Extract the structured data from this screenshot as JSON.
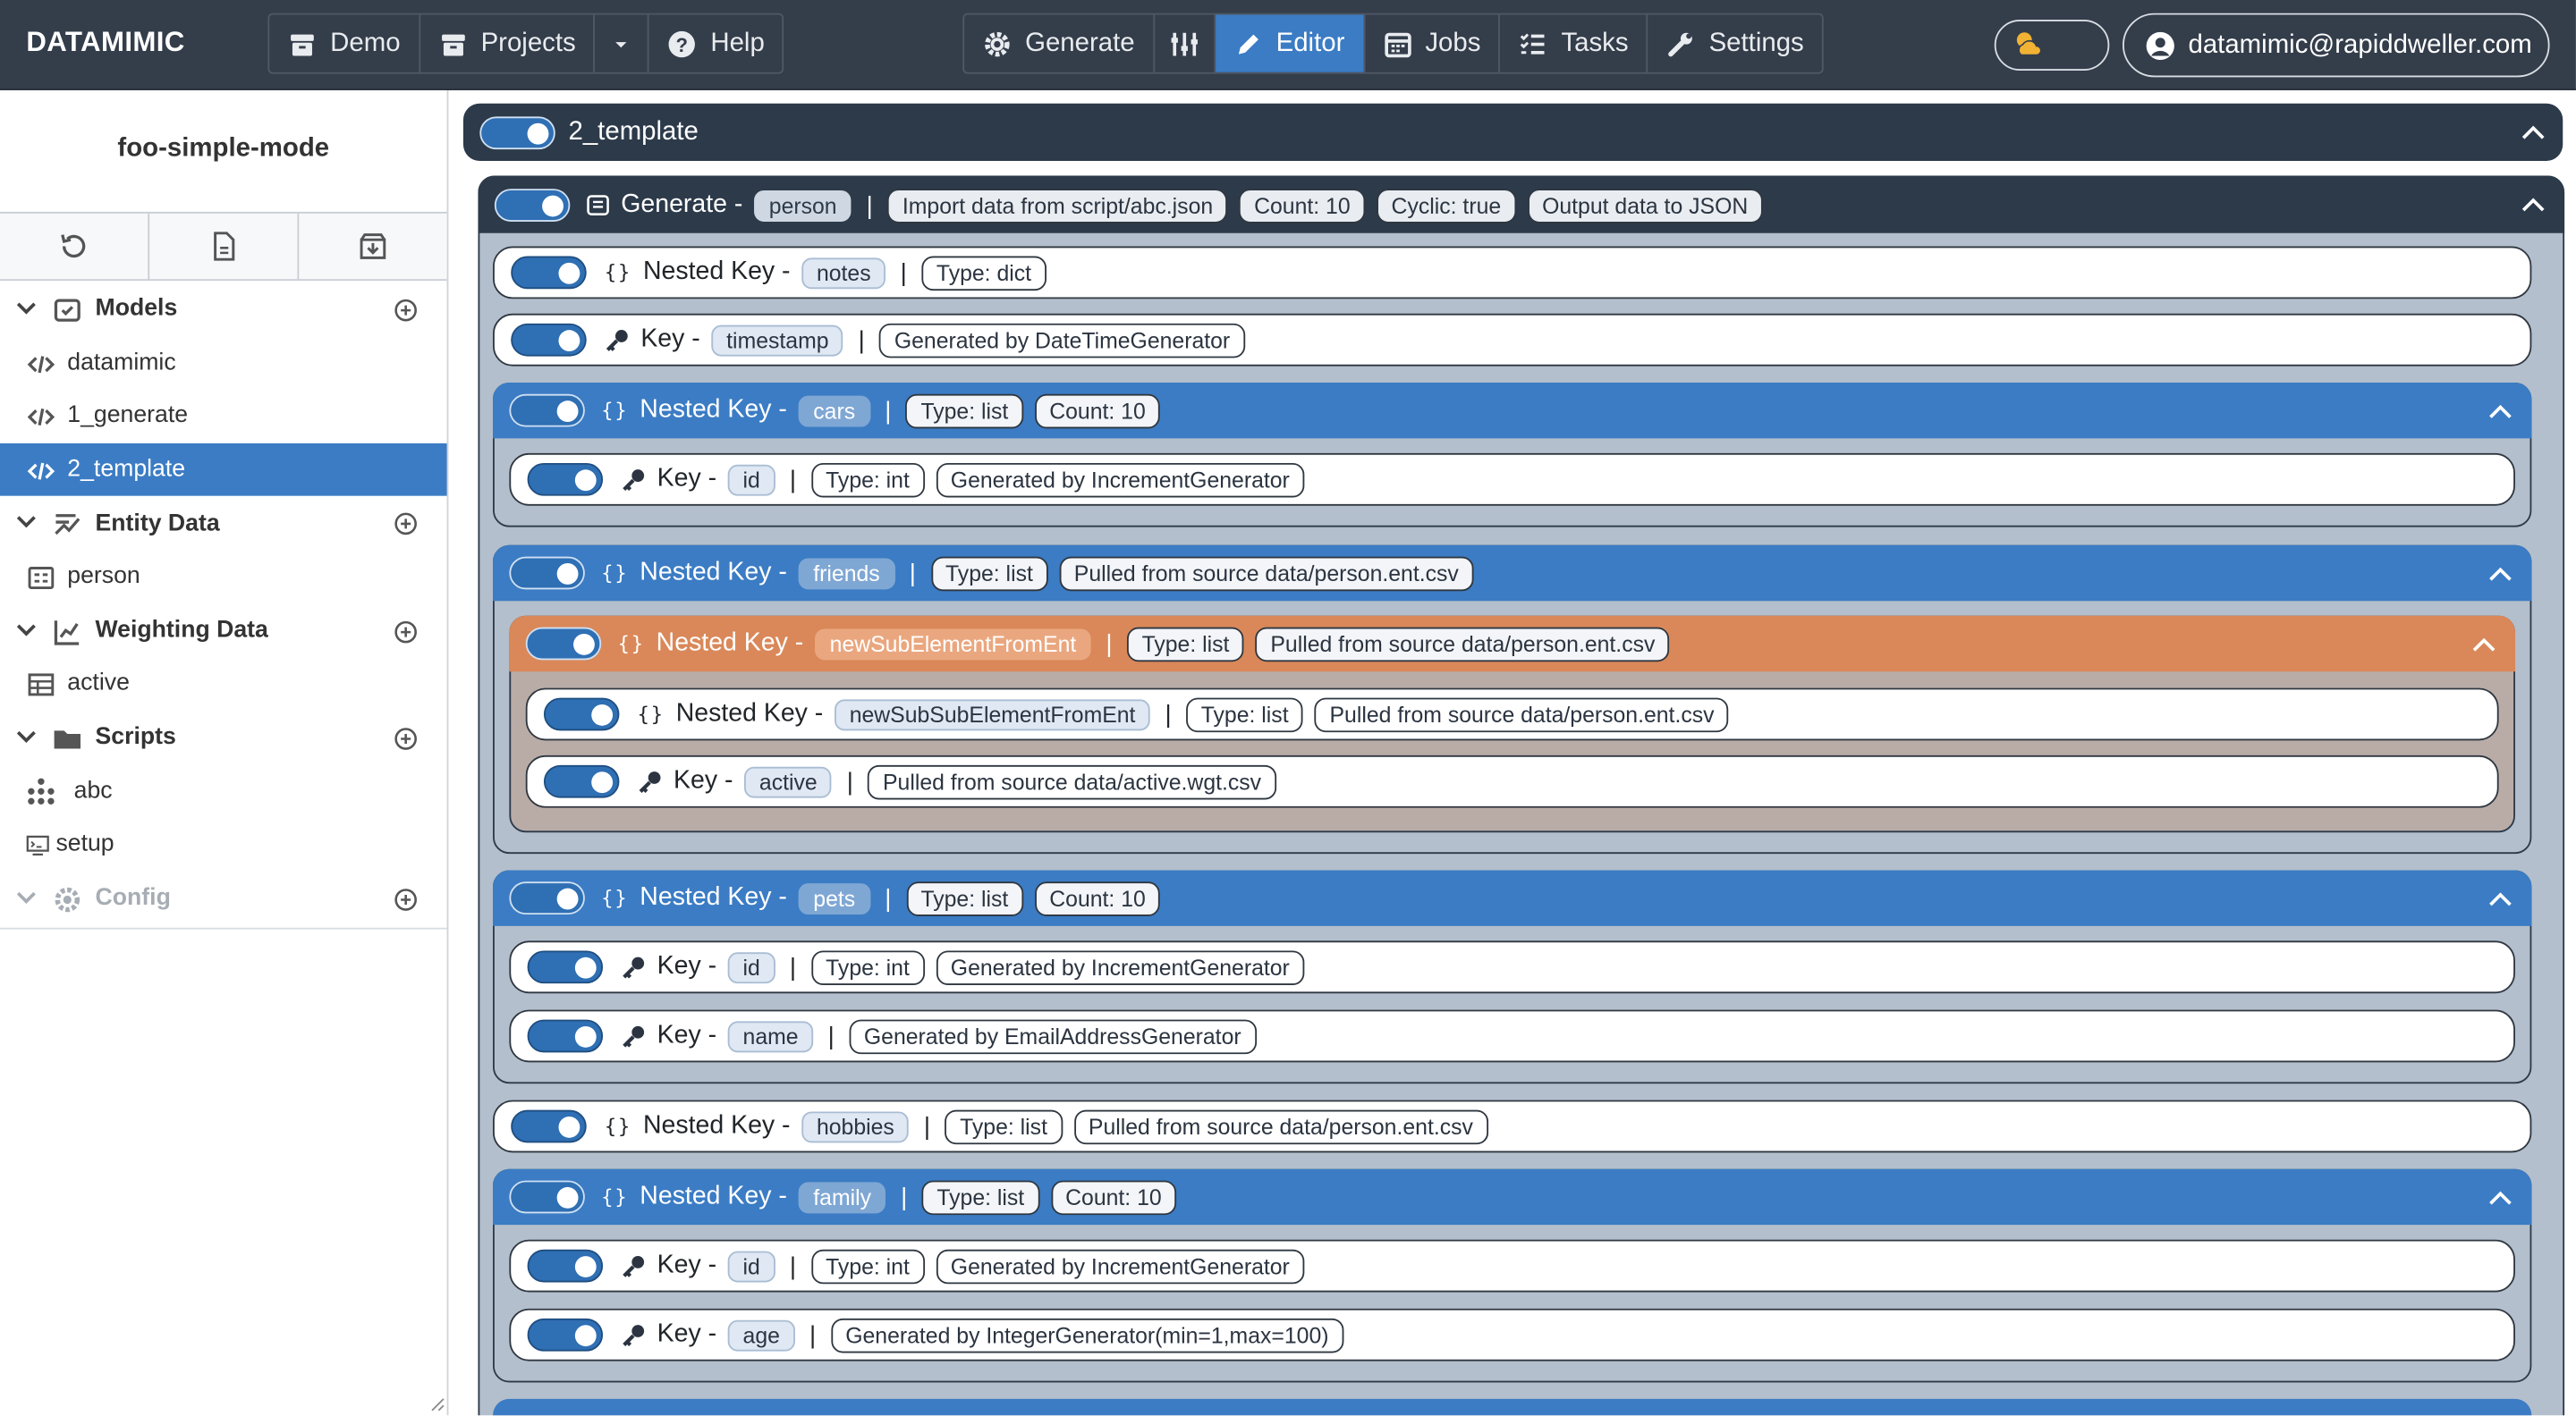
{
  "app": {
    "brand": "DATAMIMIC"
  },
  "nav": {
    "left": [
      {
        "label": "Demo",
        "icon": "archive-icon"
      },
      {
        "label": "Projects",
        "icon": "archive-icon"
      }
    ],
    "help": "Help",
    "center": [
      {
        "label": "Generate"
      },
      {
        "label": "Editor"
      },
      {
        "label": "Jobs"
      },
      {
        "label": "Tasks"
      },
      {
        "label": "Settings"
      }
    ],
    "user": "datamimic@rapiddweller.com"
  },
  "sidebar": {
    "project": "foo-simple-mode",
    "groups": {
      "models": "Models",
      "entity": "Entity Data",
      "weighting": "Weighting Data",
      "scripts": "Scripts",
      "config": "Config"
    },
    "items": {
      "m1": "datamimic",
      "m2": "1_generate",
      "m3": "2_template",
      "e1": "person",
      "w1": "active",
      "s1": "abc",
      "s2": "setup"
    }
  },
  "editor": {
    "root": "2_template",
    "generate": {
      "kind": "Generate -",
      "name": "person",
      "tags": [
        "Import data from script/abc.json",
        "Count: 10",
        "Cyclic: true",
        "Output data to JSON"
      ]
    },
    "nk": "Nested Key -",
    "k": "Key -",
    "nodes": {
      "notes": {
        "name": "notes",
        "t1": "Type: dict"
      },
      "timestamp": {
        "name": "timestamp",
        "t1": "Generated by DateTimeGenerator"
      },
      "cars": {
        "name": "cars",
        "t1": "Type: list",
        "t2": "Count: 10"
      },
      "cars_id": {
        "name": "id",
        "t1": "Type: int",
        "t2": "Generated by IncrementGenerator"
      },
      "friends": {
        "name": "friends",
        "t1": "Type: list",
        "t2": "Pulled from source data/person.ent.csv"
      },
      "newSub": {
        "name": "newSubElementFromEnt",
        "t1": "Type: list",
        "t2": "Pulled from source data/person.ent.csv"
      },
      "newSubSub": {
        "name": "newSubSubElementFromEnt",
        "t1": "Type: list",
        "t2": "Pulled from source data/person.ent.csv"
      },
      "active": {
        "name": "active",
        "t1": "Pulled from source data/active.wgt.csv"
      },
      "pets": {
        "name": "pets",
        "t1": "Type: list",
        "t2": "Count: 10"
      },
      "pets_id": {
        "name": "id",
        "t1": "Type: int",
        "t2": "Generated by IncrementGenerator"
      },
      "pets_name": {
        "name": "name",
        "t1": "Generated by EmailAddressGenerator"
      },
      "hobbies": {
        "name": "hobbies",
        "t1": "Type: list",
        "t2": "Pulled from source data/person.ent.csv"
      },
      "family": {
        "name": "family",
        "t1": "Type: list",
        "t2": "Count: 10"
      },
      "family_id": {
        "name": "id",
        "t1": "Type: int",
        "t2": "Generated by IncrementGenerator"
      },
      "family_age": {
        "name": "age",
        "t1": "Generated by IntegerGenerator(min=1,max=100)"
      }
    }
  }
}
